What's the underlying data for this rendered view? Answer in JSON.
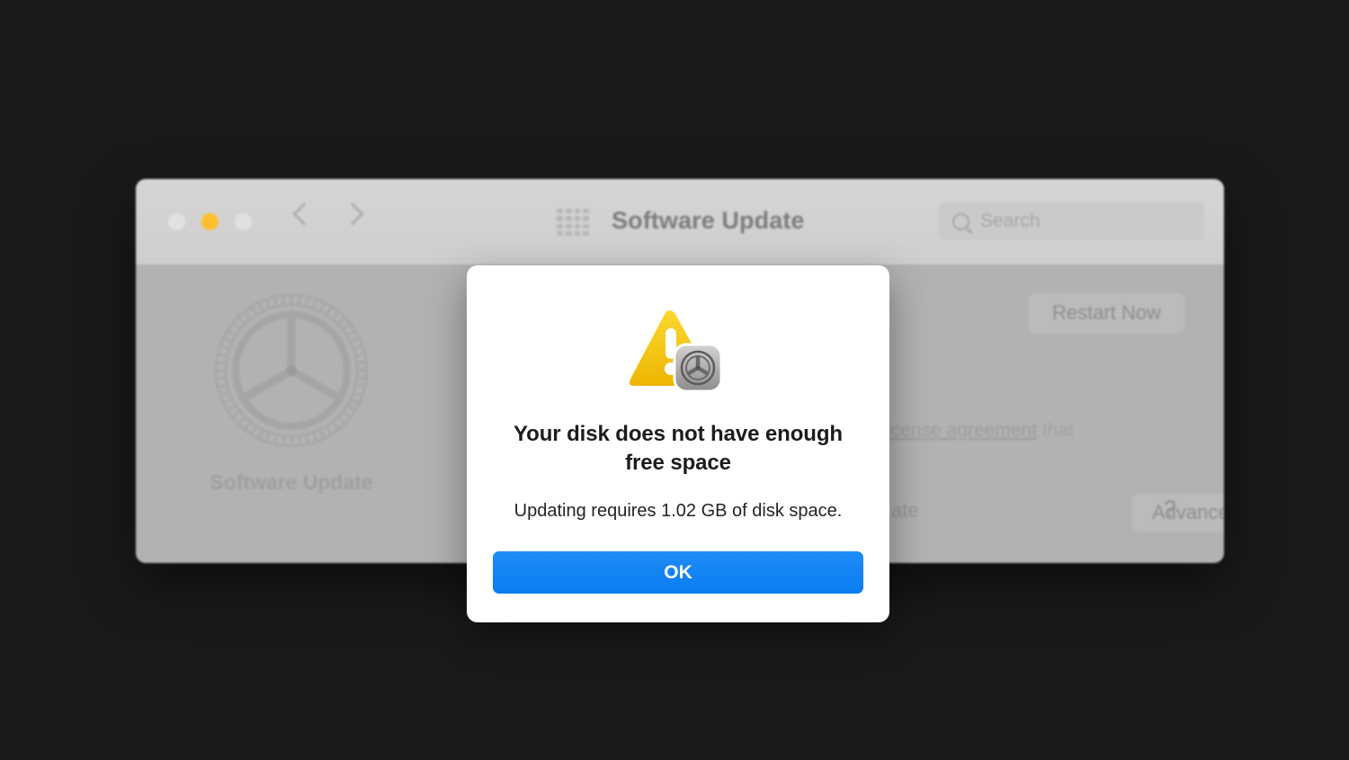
{
  "desktop": {
    "background_color": "#1a1a1a"
  },
  "prefs_window": {
    "titlebar": {
      "title": "Software Update",
      "traffic_lights": [
        {
          "name": "close-button",
          "color": "#e3e1df"
        },
        {
          "name": "minimize-button",
          "color": "#ffbe2e"
        },
        {
          "name": "zoom-button",
          "color": "#e3e1df"
        }
      ],
      "back_icon": "chevron-left-icon",
      "forward_icon": "chevron-right-icon",
      "grid_icon": "grid-view-icon",
      "search": {
        "icon": "search-icon",
        "placeholder": "Search",
        "value": ""
      }
    },
    "body": {
      "app_icon": "system-preferences-gear-icon",
      "app_caption": "Software Update",
      "restart_button": "Restart Now",
      "license_text_partial": "l license agreement",
      "license_text_tail": " that",
      "update_label_partial": "ate",
      "advanced_button": "Advanced...",
      "help_button": "?"
    }
  },
  "alert": {
    "icon": "warning-triangle-icon",
    "badge_icon": "system-preferences-gear-badge-icon",
    "title": "Your disk does not have enough free space",
    "message": "Updating requires 1.02 GB of disk space.",
    "ok_button": "OK",
    "accent_color": "#0a7cf0",
    "warning_color": "#f5c518"
  }
}
